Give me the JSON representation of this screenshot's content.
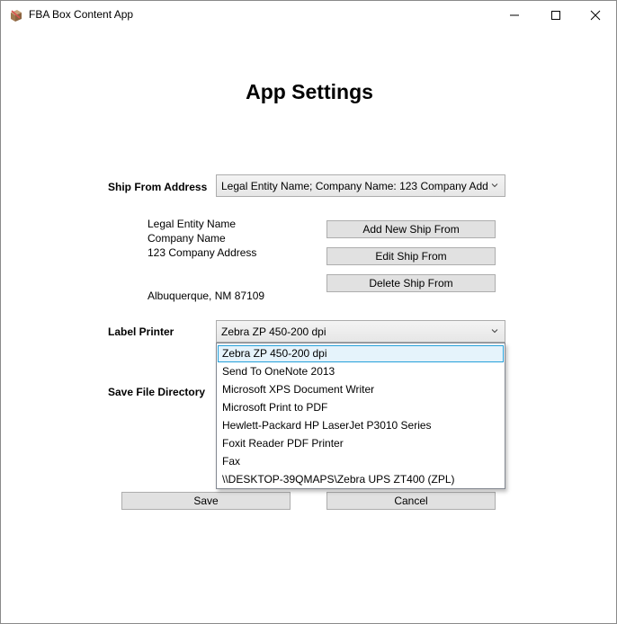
{
  "window": {
    "title": "FBA Box Content App"
  },
  "page": {
    "heading": "App Settings"
  },
  "ship_from": {
    "label": "Ship From Address",
    "selected": "Legal Entity Name; Company Name:  123 Company Add",
    "address_lines": [
      "Legal Entity Name",
      "Company Name",
      "123 Company Address"
    ],
    "city_line": "Albuquerque, NM 87109",
    "add_button": "Add New Ship From",
    "edit_button": "Edit Ship From",
    "delete_button": "Delete Ship From"
  },
  "label_printer": {
    "label": "Label Printer",
    "selected": "Zebra  ZP 450-200 dpi",
    "options": [
      "Zebra  ZP 450-200 dpi",
      "Send To OneNote 2013",
      "Microsoft XPS Document Writer",
      "Microsoft Print to PDF",
      "Hewlett-Packard HP LaserJet P3010 Series",
      "Foxit Reader PDF Printer",
      "Fax",
      "\\\\DESKTOP-39QMAPS\\Zebra UPS ZT400 (ZPL)"
    ],
    "highlighted_option": "Zebra  ZP 450-200 dpi"
  },
  "save_dir": {
    "label": "Save File Directory"
  },
  "footer": {
    "save_button": "Save",
    "cancel_button": "Cancel"
  },
  "colors": {
    "selection_bg": "#e5f3fb",
    "selection_border": "#26a0da",
    "button_bg": "#e1e1e1"
  }
}
